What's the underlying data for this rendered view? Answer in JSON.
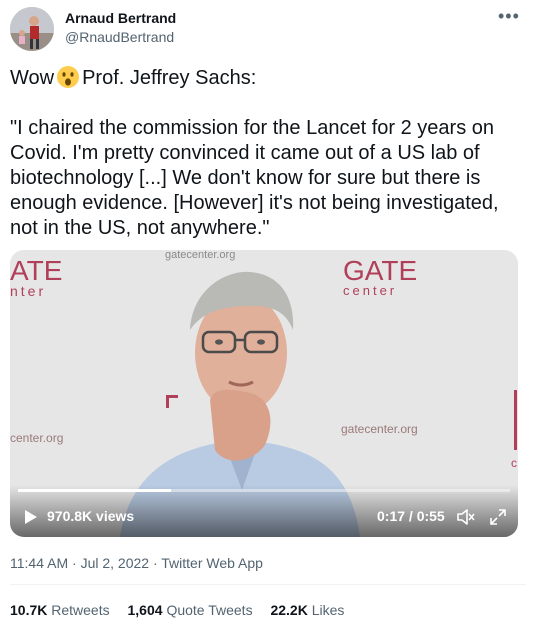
{
  "author": {
    "name": "Arnaud Bertrand",
    "handle": "@RnaudBertrand"
  },
  "more_icon": "more-horizontal-icon",
  "tweet": {
    "text_before_emoji": "Wow",
    "emoji": "astonished-face-emoji",
    "text_after_emoji": "Prof. Jeffrey Sachs:",
    "quote": "\"I chaired the commission for the Lancet for 2 years on Covid. I'm pretty convinced it came out of a US lab of biotechnology [...] We don't know for sure but there is enough evidence. [However] it's not being investigated, not in the US, not anywhere.\""
  },
  "video": {
    "backdrop": {
      "logo_left": "ATE",
      "logo_left_sub": "nter",
      "logo_right": "GATE",
      "logo_right_sub": "center",
      "url_top": "gatecenter.org",
      "url_left": "center.org",
      "url_right": "gatecenter.org",
      "edge_letter": "c"
    },
    "views": "970.8K views",
    "time": "0:17 / 0:55",
    "progress": 0.31,
    "icons": {
      "play": "play-icon",
      "volume": "volume-muted-icon",
      "fullscreen": "fullscreen-icon"
    },
    "accent_color": "#b0405a"
  },
  "meta": {
    "time": "11:44 AM",
    "separator": "·",
    "date": "Jul 2, 2022",
    "source": "Twitter Web App"
  },
  "stats": {
    "retweets_count": "10.7K",
    "retweets_label": "Retweets",
    "quotes_count": "1,604",
    "quotes_label": "Quote Tweets",
    "likes_count": "22.2K",
    "likes_label": "Likes"
  }
}
